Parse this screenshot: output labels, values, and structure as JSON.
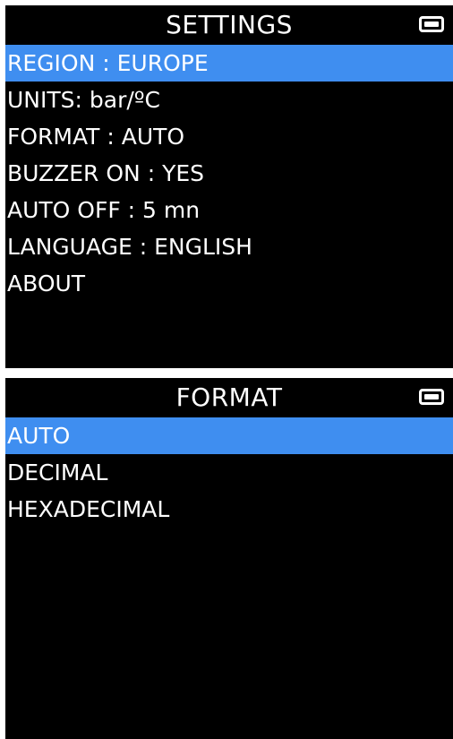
{
  "colors": {
    "background": "#000000",
    "text": "#ffffff",
    "highlight": "#3f8ef0"
  },
  "settings_screen": {
    "title": "SETTINGS",
    "battery_icon": "battery-full-icon",
    "items": [
      {
        "label": "REGION : EUROPE",
        "selected": true
      },
      {
        "label": "UNITS: bar/ºC",
        "selected": false
      },
      {
        "label": "FORMAT : AUTO",
        "selected": false
      },
      {
        "label": "BUZZER ON : YES",
        "selected": false
      },
      {
        "label": "AUTO OFF : 5 mn",
        "selected": false
      },
      {
        "label": "LANGUAGE : ENGLISH",
        "selected": false
      },
      {
        "label": "ABOUT",
        "selected": false
      }
    ]
  },
  "format_screen": {
    "title": "FORMAT",
    "battery_icon": "battery-full-icon",
    "items": [
      {
        "label": "AUTO",
        "selected": true
      },
      {
        "label": "DECIMAL",
        "selected": false
      },
      {
        "label": "HEXADECIMAL",
        "selected": false
      }
    ]
  }
}
